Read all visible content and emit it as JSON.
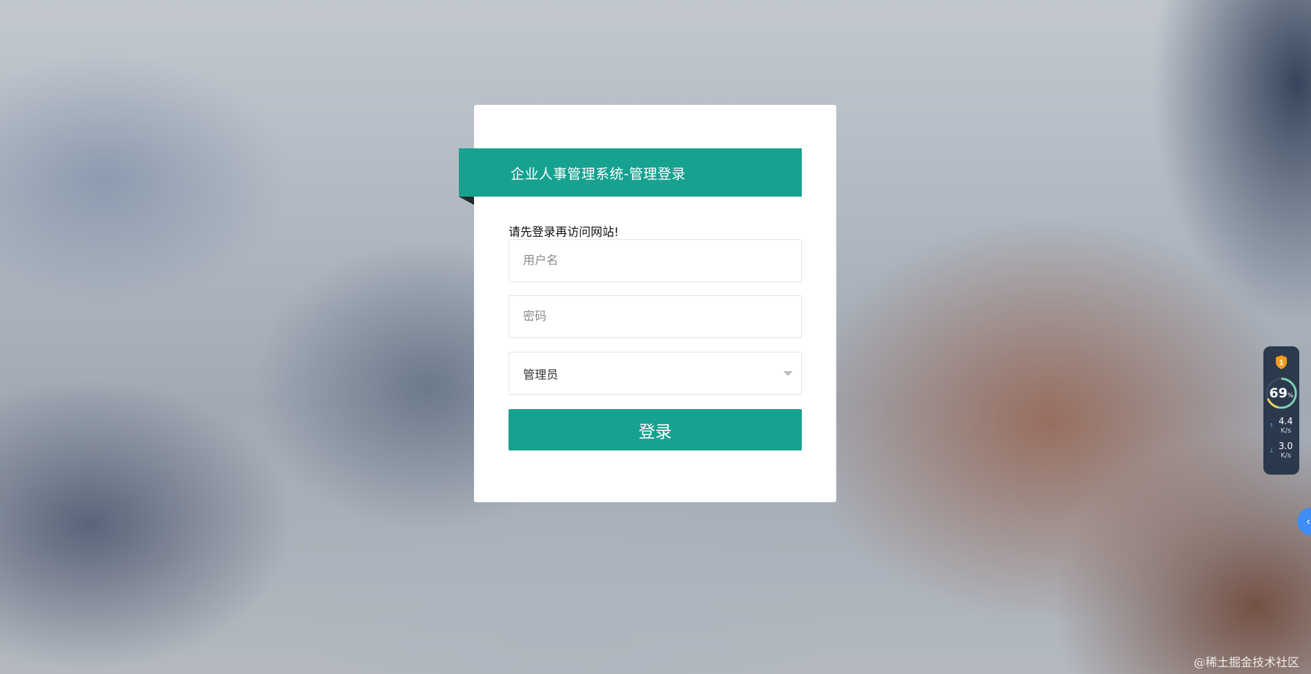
{
  "login": {
    "title": "企业人事管理系统-管理登录",
    "notice": "请先登录再访问网站!",
    "username_placeholder": "用户名",
    "password_placeholder": "密码",
    "role_selected": "管理员",
    "submit_label": "登录"
  },
  "colors": {
    "accent": "#17a290"
  },
  "widget": {
    "badge": "1",
    "percent": "69",
    "percent_unit": "%",
    "upload_rate": "4.4",
    "download_rate": "3.0",
    "rate_unit": "K/s",
    "icons": [
      "shield-icon",
      "up-arrow-icon",
      "down-arrow-icon"
    ]
  },
  "side_tab": {
    "icon": "chevron-left-icon"
  },
  "watermark": "@稀土掘金技术社区"
}
